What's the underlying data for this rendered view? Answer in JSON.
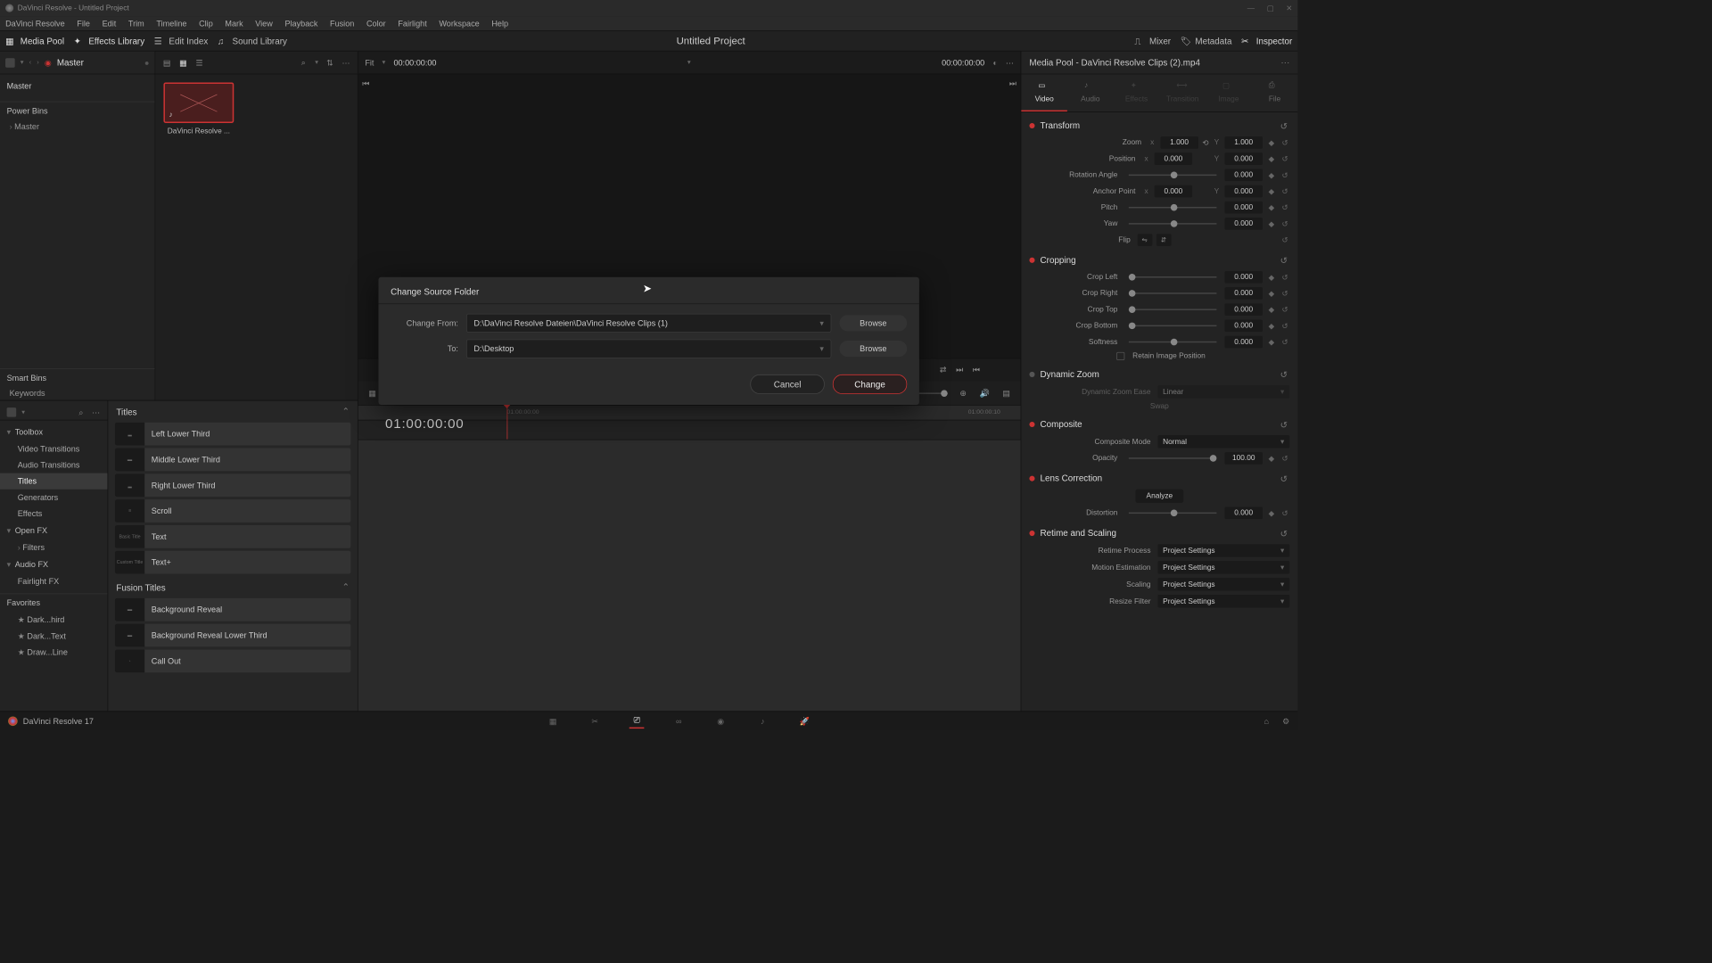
{
  "titlebar": {
    "text": "DaVinci Resolve - Untitled Project"
  },
  "menu": [
    "DaVinci Resolve",
    "File",
    "Edit",
    "Trim",
    "Timeline",
    "Clip",
    "Mark",
    "View",
    "Playback",
    "Fusion",
    "Color",
    "Fairlight",
    "Workspace",
    "Help"
  ],
  "toolbar": {
    "media_pool": "Media Pool",
    "effects_library": "Effects Library",
    "edit_index": "Edit Index",
    "sound_library": "Sound Library",
    "project_title": "Untitled Project",
    "mixer": "Mixer",
    "metadata": "Metadata",
    "inspector": "Inspector"
  },
  "mediapool": {
    "master": "Master",
    "root": "Master",
    "power_bins": "Power Bins",
    "power_master": "Master",
    "smart_bins": "Smart Bins",
    "keywords": "Keywords",
    "clip_name": "DaVinci Resolve ..."
  },
  "viewer": {
    "fit": "Fit",
    "tc_left": "00:00:00:00",
    "tc_right": "00:00:00:00"
  },
  "fx": {
    "toolbox": "Toolbox",
    "video_transitions": "Video Transitions",
    "audio_transitions": "Audio Transitions",
    "titles": "Titles",
    "generators": "Generators",
    "effects": "Effects",
    "openfx": "Open FX",
    "filters": "Filters",
    "audiofx": "Audio FX",
    "fairlightfx": "Fairlight FX",
    "favorites": "Favorites",
    "fav1": "Dark...hird",
    "fav2": "Dark...Text",
    "fav3": "Draw...Line",
    "cat_titles": "Titles",
    "cat_fusion": "Fusion Titles",
    "items": [
      "Left Lower Third",
      "Middle Lower Third",
      "Right Lower Third",
      "Scroll",
      "Text",
      "Text+"
    ],
    "fusion_items": [
      "Background Reveal",
      "Background Reveal Lower Third",
      "Call Out"
    ],
    "preview_basic": "Basic Title",
    "preview_custom": "Custom Title"
  },
  "timeline": {
    "tc": "01:00:00:00",
    "tick1": "01:00:00:00",
    "tick2": "01:00:00:10"
  },
  "inspector": {
    "header": "Media Pool - DaVinci Resolve Clips (2).mp4",
    "tabs": {
      "video": "Video",
      "audio": "Audio",
      "effects": "Effects",
      "transition": "Transition",
      "image": "Image",
      "file": "File"
    },
    "transform": {
      "title": "Transform",
      "zoom": "Zoom",
      "zoom_x": "1.000",
      "zoom_y": "1.000",
      "position": "Position",
      "pos_x": "0.000",
      "pos_y": "0.000",
      "rotation": "Rotation Angle",
      "rot_v": "0.000",
      "anchor": "Anchor Point",
      "anc_x": "0.000",
      "anc_y": "0.000",
      "pitch": "Pitch",
      "pitch_v": "0.000",
      "yaw": "Yaw",
      "yaw_v": "0.000",
      "flip": "Flip"
    },
    "cropping": {
      "title": "Cropping",
      "left": "Crop Left",
      "left_v": "0.000",
      "right": "Crop Right",
      "right_v": "0.000",
      "top": "Crop Top",
      "top_v": "0.000",
      "bottom": "Crop Bottom",
      "bottom_v": "0.000",
      "soft": "Softness",
      "soft_v": "0.000",
      "retain": "Retain Image Position"
    },
    "dynzoom": {
      "title": "Dynamic Zoom",
      "ease": "Dynamic Zoom Ease",
      "linear": "Linear",
      "swap": "Swap"
    },
    "composite": {
      "title": "Composite",
      "mode_l": "Composite Mode",
      "mode_v": "Normal",
      "opacity_l": "Opacity",
      "opacity_v": "100.00"
    },
    "lens": {
      "title": "Lens Correction",
      "analyze": "Analyze",
      "dist_l": "Distortion",
      "dist_v": "0.000"
    },
    "retime": {
      "title": "Retime and Scaling",
      "process_l": "Retime Process",
      "process_v": "Project Settings",
      "motion_l": "Motion Estimation",
      "motion_v": "Project Settings",
      "scaling_l": "Scaling",
      "scaling_v": "Project Settings",
      "resize_l": "Resize Filter",
      "resize_v": "Project Settings"
    }
  },
  "dialog": {
    "title": "Change Source Folder",
    "from_l": "Change From:",
    "from_v": "D:\\DaVinci Resolve Dateien\\DaVinci Resolve Clips (1)",
    "to_l": "To:",
    "to_v": "D:\\Desktop",
    "browse": "Browse",
    "cancel": "Cancel",
    "change": "Change"
  },
  "footer": {
    "brand": "DaVinci Resolve 17"
  }
}
